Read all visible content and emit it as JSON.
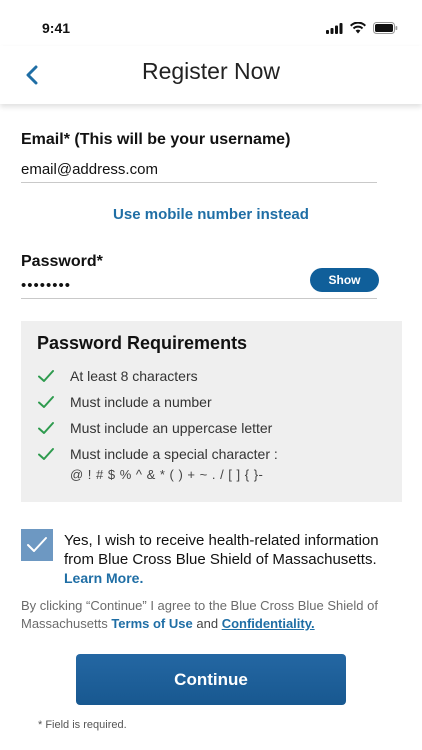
{
  "status_bar": {
    "time": "9:41"
  },
  "nav": {
    "title": "Register Now"
  },
  "email": {
    "label": "Email* (This will be your username)",
    "value": "email@address.com"
  },
  "alt_login_link": "Use mobile number instead",
  "password": {
    "label": "Password*",
    "value": "••••••••",
    "show_label": "Show"
  },
  "requirements": {
    "title": "Password Requirements",
    "items": [
      "At least 8 characters",
      "Must include a number",
      "Must include an uppercase letter",
      "Must include a special character :"
    ],
    "special_chars": "@ ! # $ % ^ & * ( ) + ~ . / [ ] { }-"
  },
  "opt_in": {
    "checked": true,
    "text": "Yes, I wish to receive health-related information from Blue Cross Blue Shield of Massachusetts.",
    "link": "Learn More."
  },
  "terms": {
    "prefix": "By clicking “Continue” I agree to the Blue Cross Blue Shield of Massachusetts",
    "terms_link": "Terms of Use",
    "and": "and",
    "confidentiality_link": "Confidentiality",
    "period": "."
  },
  "continue_label": "Continue",
  "required_note": "* Field is required.",
  "colors": {
    "accent_blue": "#1f6ea5",
    "button_blue": "#185890",
    "check_green": "#2e9b4e",
    "checkbox_fill": "#6d98c2"
  },
  "icons": [
    "back-chevron-icon",
    "signal-icon",
    "wifi-icon",
    "battery-icon",
    "checkmark-icon"
  ]
}
